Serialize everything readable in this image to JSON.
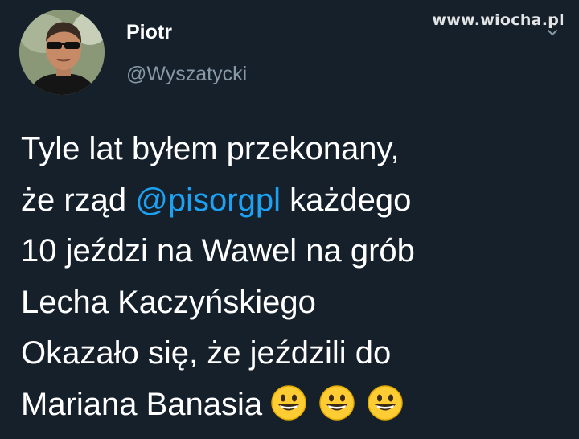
{
  "watermark": "www.wiocha.pl",
  "tweet": {
    "author": {
      "name": "Piotr",
      "handle": "@Wyszatycki"
    },
    "lines": [
      {
        "text": "Tyle lat byłem przekonany,"
      },
      {
        "before": "że rząd ",
        "mention": "@pisorgpl",
        "after": " każdego"
      },
      {
        "text": "10 jeździ na Wawel na grób"
      },
      {
        "text": "Lecha Kaczyńskiego"
      },
      {
        "text": "Okazało się, że jeździli do"
      },
      {
        "text": "Mariana Banasia"
      }
    ],
    "emojis": [
      "grinning-face-icon",
      "grinning-face-icon",
      "grinning-face-icon"
    ]
  },
  "colors": {
    "background": "#15202b",
    "text": "#ffffff",
    "handle": "#8899a6",
    "mention": "#1da1f2",
    "emoji": "#ffcc33"
  }
}
